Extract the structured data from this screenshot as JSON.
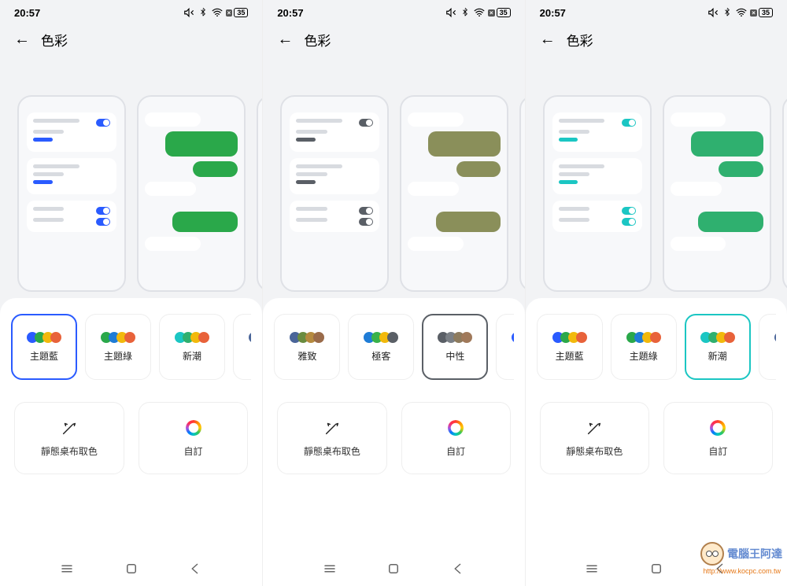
{
  "status": {
    "time": "20:57",
    "battery": "35"
  },
  "header": {
    "title": "色彩"
  },
  "actions": {
    "wallpaper": "靜態桌布取色",
    "custom": "自訂"
  },
  "themes": [
    {
      "key": "blue",
      "label": "主題藍",
      "border": "#2a5bff",
      "dots": [
        "#2a5bff",
        "#2aa84a",
        "#f2b90c",
        "#e8623a"
      ]
    },
    {
      "key": "green",
      "label": "主題綠",
      "border": "#2aa84a",
      "dots": [
        "#2aa84a",
        "#1f7cd6",
        "#f2b90c",
        "#e8623a"
      ]
    },
    {
      "key": "trendy",
      "label": "新潮",
      "border": "#1bc6c3",
      "dots": [
        "#1bc6c3",
        "#2fb06f",
        "#f2b90c",
        "#e8623a"
      ]
    },
    {
      "key": "yazhi",
      "label": "雅致",
      "border": "#4a6599",
      "dots": [
        "#4a6599",
        "#6a8c3f",
        "#b58a3f",
        "#9a6b4a"
      ]
    },
    {
      "key": "geek",
      "label": "極客",
      "border": "#1f7cd6",
      "dots": [
        "#1f7cd6",
        "#39b24a",
        "#f2b90c",
        "#5a5f66"
      ]
    },
    {
      "key": "neutral",
      "label": "中性",
      "border": "#5a5f66",
      "dots": [
        "#5a5f66",
        "#7a7f85",
        "#8d7b5e",
        "#a0795a"
      ]
    }
  ],
  "panels": [
    {
      "selected_key": "blue",
      "accent": "#2a5bff",
      "bubble": "#2aa84a",
      "start": 0
    },
    {
      "selected_key": "neutral",
      "accent": "#5a5f66",
      "bubble": "#8a8f5a",
      "start": 3
    },
    {
      "selected_key": "trendy",
      "accent": "#1bc6c3",
      "bubble": "#2fb06f",
      "start": 0
    }
  ],
  "watermark": {
    "text": "電腦王阿達",
    "url": "http://www.kocpc.com.tw"
  }
}
